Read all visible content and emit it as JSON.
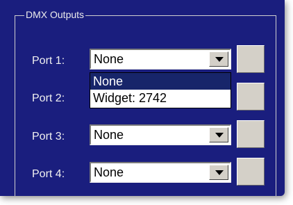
{
  "group": {
    "title": "DMX Outputs"
  },
  "ports": [
    {
      "label": "Port 1:",
      "value": "None",
      "open": true
    },
    {
      "label": "Port 2:",
      "value": ""
    },
    {
      "label": "Port 3:",
      "value": "None"
    },
    {
      "label": "Port 4:",
      "value": "None"
    }
  ],
  "dropdown": {
    "options": [
      "None",
      "Widget: 2742"
    ],
    "highlighted_index": 0
  },
  "colors": {
    "panel_background": "#1a1e7e",
    "highlight": "#17256a",
    "button_face": "#d4d0c8"
  }
}
